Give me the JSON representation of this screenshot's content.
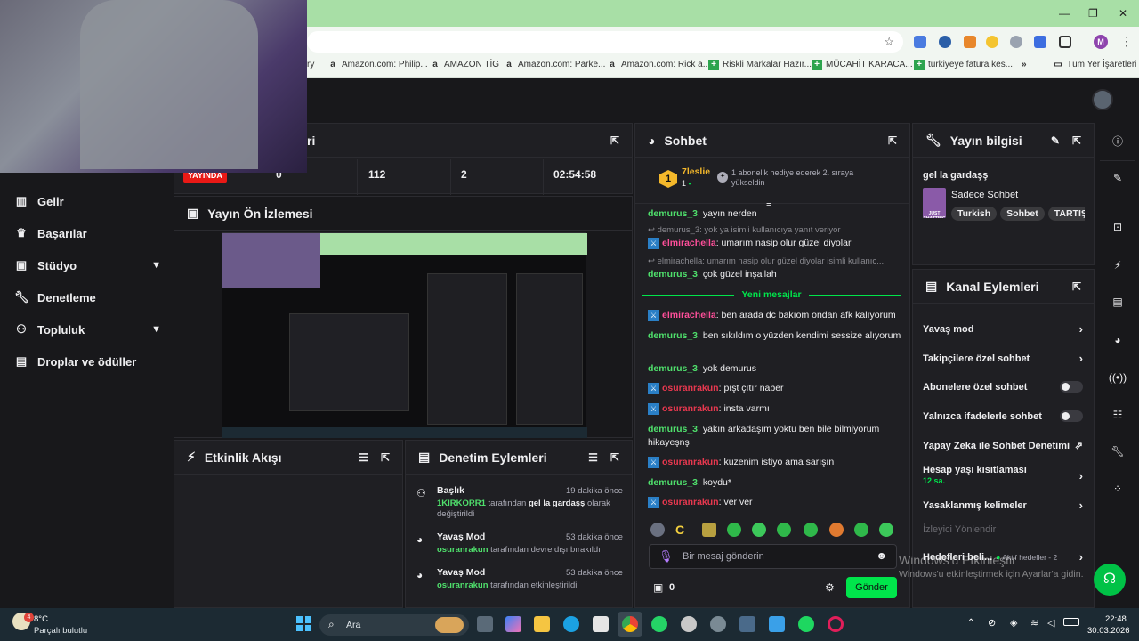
{
  "browser": {
    "bookmarks": [
      "ry",
      "Amazon.com: Philip...",
      "AMAZON TİG",
      "Amazon.com: Parke...",
      "Amazon.com: Rick a...",
      "Riskli Markalar Hazır...",
      "MÜCAHİT KARACA...",
      "türkiyeye fatura kes...",
      "»",
      "Tüm Yer İşaretleri"
    ],
    "profile_initial": "M"
  },
  "leftnav": {
    "items": [
      {
        "label": "Gelir",
        "icon": "chart-icon"
      },
      {
        "label": "Başarılar",
        "icon": "trophy-icon"
      },
      {
        "label": "Stüdyo",
        "icon": "studio-icon",
        "expand": true
      },
      {
        "label": "Denetleme",
        "icon": "wrench-icon"
      },
      {
        "label": "Topluluk",
        "icon": "people-icon",
        "expand": true
      },
      {
        "label": "Droplar ve ödüller",
        "icon": "gift-icon"
      }
    ]
  },
  "stats": {
    "title": "ri",
    "live": "YAYINDA",
    "viewers": "0",
    "followers": "112",
    "subs": "2",
    "time": "02:54:58"
  },
  "preview": {
    "title": "Yayın Ön İzlemesi"
  },
  "activity": {
    "title": "Etkinlik Akışı"
  },
  "modlog": {
    "title": "Denetim Eylemleri",
    "items": [
      {
        "action": "Başlık",
        "time": "19 dakika önce",
        "user": "1KIRKORR1",
        "mid": " tarafından ",
        "value": "gel la gardaşş",
        "tail": " olarak değiştirildi"
      },
      {
        "action": "Yavaş Mod",
        "time": "53 dakika önce",
        "user": "osuranrakun",
        "mid": " tarafından devre dışı bırakıldı",
        "value": "",
        "tail": ""
      },
      {
        "action": "Yavaş Mod",
        "time": "53 dakika önce",
        "user": "osuranrakun",
        "mid": " tarafından etkinleştirildi",
        "value": "",
        "tail": ""
      }
    ]
  },
  "chat": {
    "title": "Sohbet",
    "hype_user": "7leslie",
    "hype_rank": "1",
    "hype_count": "1",
    "hype_text": "1 abonelik hediye ederek 2. sıraya yükseldin",
    "new_messages": "Yeni mesajlar",
    "placeholder": "Bir mesaj gönderin",
    "points": "0",
    "send": "Gönder",
    "lines": [
      {
        "user": "demurus_3",
        "text": ": yayın nerden",
        "color": "green",
        "badge": false
      },
      {
        "reply": "demurus_3: yok ya isimli kullanıcıya yanıt veriyor"
      },
      {
        "user": "elmirachella",
        "text": ": umarım nasip olur güzel diyolar",
        "color": "pink",
        "badge": true
      },
      {
        "reply": "elmirachella: umarım nasip olur güzel diyolar isimli kullanıc..."
      },
      {
        "user": "demurus_3",
        "text": ": çok güzel inşallah",
        "color": "green",
        "badge": false
      },
      {
        "user": "elmirachella",
        "text": ": ben arada dc bakıom ondan afk kalıyorum",
        "color": "pink",
        "badge": true
      },
      {
        "user": "demurus_3",
        "text": ": ben sıkıldım o yüzden kendimi sessize alıyorum",
        "color": "green",
        "badge": false
      },
      {
        "user": "demurus_3",
        "text": ": yok demurus",
        "color": "green",
        "badge": false
      },
      {
        "user": "osuranrakun",
        "text": ": pışt çıtır naber",
        "color": "red",
        "badge": true
      },
      {
        "user": "osuranrakun",
        "text": ": insta varmı",
        "color": "red",
        "badge": true
      },
      {
        "user": "demurus_3",
        "text": ": yakın arkadaşım yoktu ben bile bilmiyorum hikayeşnş",
        "color": "green",
        "badge": false
      },
      {
        "user": "osuranrakun",
        "text": ": kuzenim istiyo ama sarışın",
        "color": "red",
        "badge": true
      },
      {
        "user": "demurus_3",
        "text": ": koydu*",
        "color": "green",
        "badge": false
      },
      {
        "user": "osuranrakun",
        "text": ": ver ver",
        "color": "red",
        "badge": true
      }
    ]
  },
  "info": {
    "title": "Yayın bilgisi",
    "stream_title": "gel la gardaşş",
    "category": "Sadece Sohbet",
    "category_thumb": "JUST CHATTING",
    "tags": [
      "Turkish",
      "Sohbet",
      "TARTIŞ"
    ]
  },
  "actions": {
    "title": "Kanal Eylemleri",
    "rows": [
      {
        "label": "Yavaş mod",
        "kind": "go"
      },
      {
        "label": "Takipçilere özel sohbet",
        "kind": "go"
      },
      {
        "label": "Abonelere özel sohbet",
        "kind": "toggle"
      },
      {
        "label": "Yalnızca ifadelerle sohbet",
        "kind": "toggle"
      },
      {
        "label": "Yapay Zeka ile Sohbet Denetimi",
        "kind": "ext"
      },
      {
        "label": "Hesap yaşı kısıtlaması",
        "sub": "12 sa.",
        "kind": "go"
      },
      {
        "label": "Yasaklanmış kelimeler",
        "kind": "go"
      },
      {
        "label": "İzleyici Yönlendir",
        "kind": "none"
      },
      {
        "label": "Hedefleri beli...",
        "sub": "Aktif hedefler - 2",
        "kind": "go"
      }
    ]
  },
  "watermark": {
    "line1": "Windows'u Etkinleştir",
    "line2": "Windows'u etkinleştirmek için Ayarlar'a gidin."
  },
  "taskbar": {
    "weather_temp": "8°C",
    "weather_text": "Parçalı bulutlu",
    "weather_badge": "4",
    "search": "Ara",
    "time": "22:48",
    "date": "30.03.2026"
  },
  "colors": {
    "accent": "#00e54b",
    "live": "#e91916",
    "bg": "#18181b"
  }
}
